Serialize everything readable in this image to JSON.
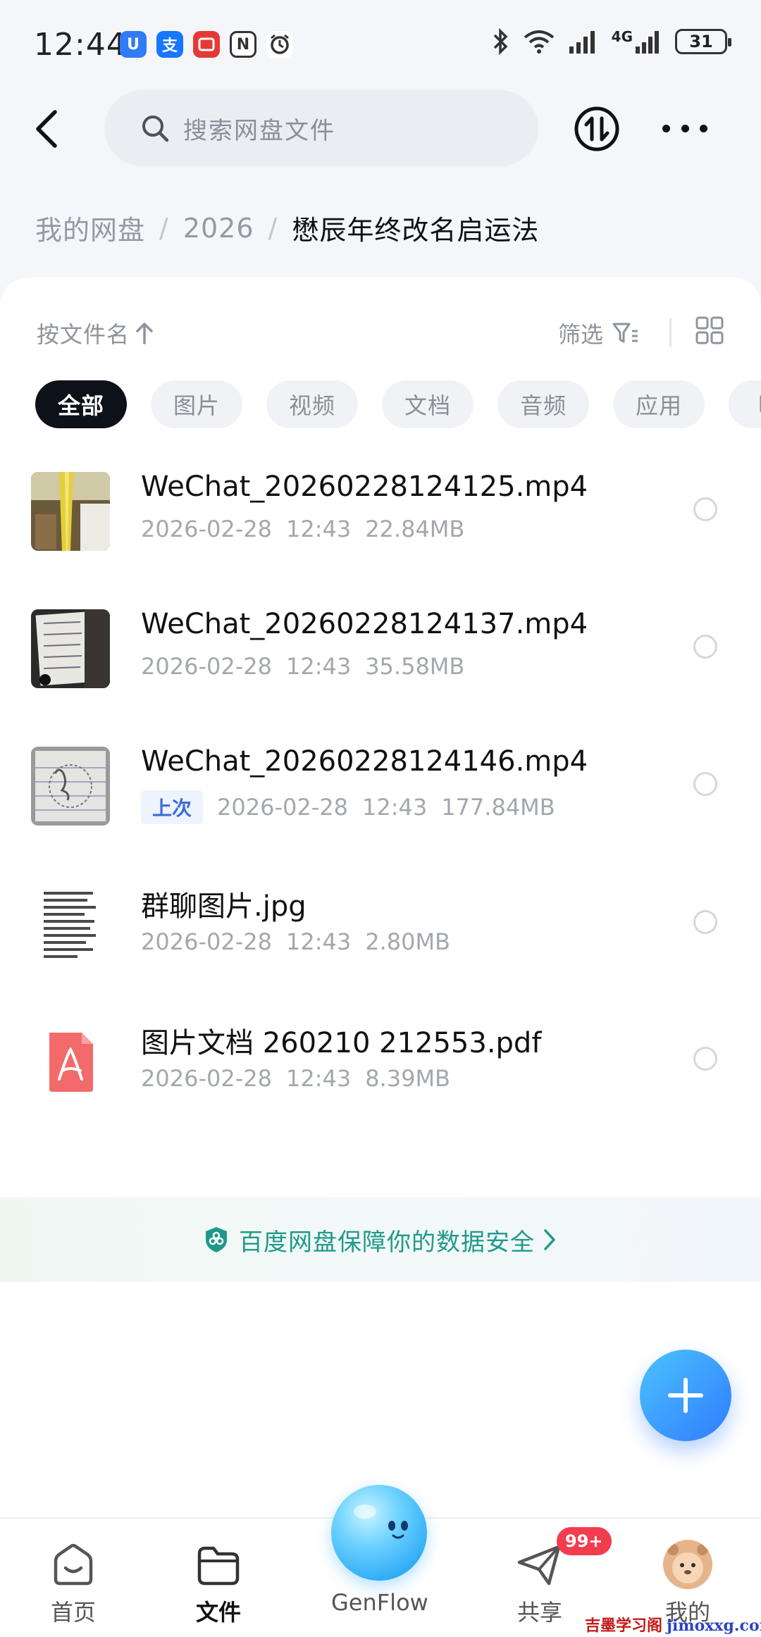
{
  "status_bar": {
    "time": "12:44",
    "apps": [
      {
        "icon": "u-app-icon",
        "text": "U",
        "color": "#2f7cf6"
      },
      {
        "icon": "alipay-icon",
        "text": "支",
        "color": "#1677ff"
      },
      {
        "icon": "red-app-icon",
        "text": "",
        "color": "#e53935"
      },
      {
        "icon": "nfc-icon",
        "text": "N",
        "color": "#444444"
      },
      {
        "icon": "alarm-icon",
        "text": "",
        "color": "#444444"
      }
    ],
    "network": "4G",
    "battery": "31"
  },
  "search": {
    "placeholder": "搜索网盘文件"
  },
  "breadcrumb": {
    "root": "我的网盘",
    "middle": "2026",
    "current": "懋辰年终改名启运法"
  },
  "toolbar": {
    "sort_label": "按文件名",
    "filter_label": "筛选"
  },
  "chips": [
    "全部",
    "图片",
    "视频",
    "文档",
    "音频",
    "应用",
    "BT"
  ],
  "files": [
    {
      "name": "WeChat_20260228124125.mp4",
      "tag": "",
      "date": "2026-02-28",
      "time": "12:43",
      "size": "22.84MB",
      "thumb": "video-thumb-1"
    },
    {
      "name": "WeChat_20260228124137.mp4",
      "tag": "",
      "date": "2026-02-28",
      "time": "12:43",
      "size": "35.58MB",
      "thumb": "video-thumb-2"
    },
    {
      "name": "WeChat_20260228124146.mp4",
      "tag": "上次",
      "date": "2026-02-28",
      "time": "12:43",
      "size": "177.84MB",
      "thumb": "video-thumb-3"
    },
    {
      "name": "群聊图片.jpg",
      "tag": "",
      "date": "2026-02-28",
      "time": "12:43",
      "size": "2.80MB",
      "thumb": "image-thumb"
    },
    {
      "name": "图片文档 260210 212553.pdf",
      "tag": "",
      "date": "2026-02-28",
      "time": "12:43",
      "size": "8.39MB",
      "thumb": "pdf-icon"
    }
  ],
  "security_banner": {
    "text": "百度网盘保障你的数据安全"
  },
  "bottom_nav": {
    "home": "首页",
    "files": "文件",
    "genflow": "GenFlow",
    "share": "共享",
    "share_badge": "99+",
    "mine": "我的"
  },
  "watermark": {
    "cn": "吉墨学习阁",
    "en": "jimoxxg.com"
  },
  "colors": {
    "accent": "#2f7cff",
    "security": "#1f9a8a",
    "badge": "#f23d4f"
  }
}
